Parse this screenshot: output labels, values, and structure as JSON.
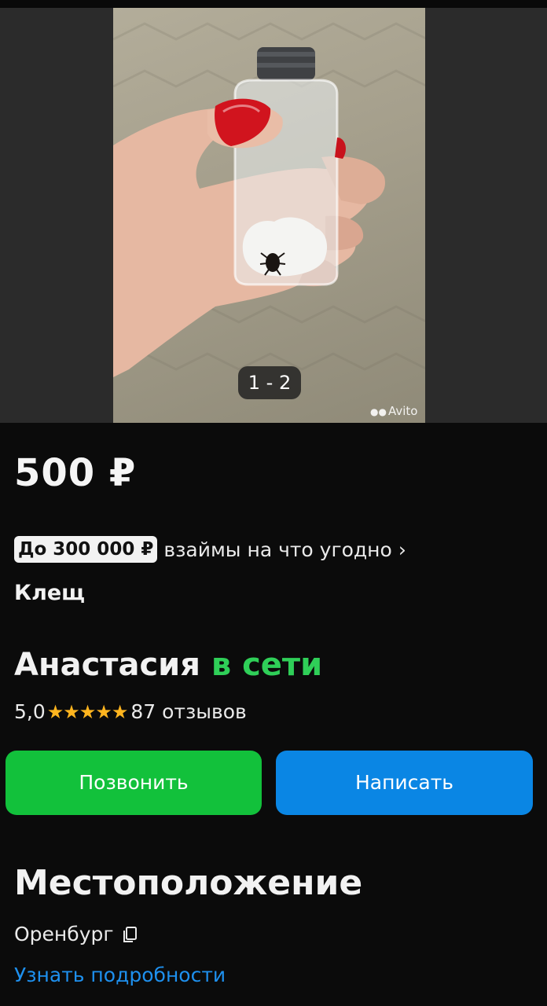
{
  "gallery": {
    "counter": "1 - 2",
    "watermark": "Avito"
  },
  "listing": {
    "price": "500 ₽",
    "title": "Клещ"
  },
  "loan": {
    "badge": "До 300 000 ₽",
    "text": "взаймы на что угодно",
    "chevron": "›"
  },
  "seller": {
    "name": "Анастасия",
    "status": "в сети",
    "rating": "5,0",
    "stars": "★★★★★",
    "reviews": "87 отзывов"
  },
  "actions": {
    "call_label": "Позвонить",
    "write_label": "Написать"
  },
  "location": {
    "heading": "Местоположение",
    "city": "Оренбург",
    "more_label": "Узнать подробности"
  },
  "colors": {
    "call_button": "#12c13b",
    "write_button": "#0a86e4",
    "online_status": "#2fcf58",
    "stars": "#ffb51f",
    "link": "#1e90ee"
  },
  "icons": {
    "copy": "copy-icon",
    "chevron": "chevron-right-icon",
    "stars": "star-icon"
  }
}
